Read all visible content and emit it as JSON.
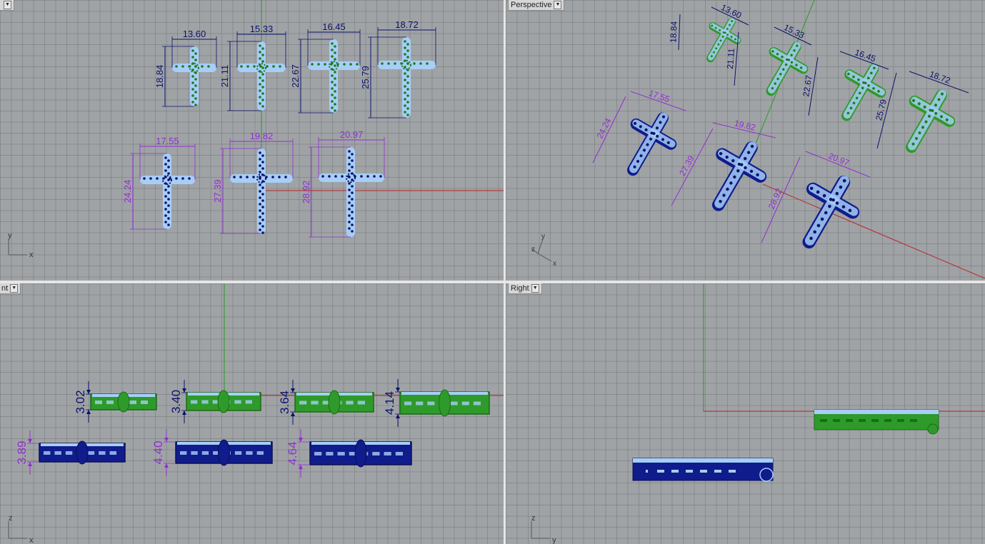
{
  "viewports": {
    "top": {
      "label": "",
      "axes": {
        "y": "y",
        "x": "x"
      }
    },
    "perspective": {
      "label": "Perspective",
      "axes": {
        "y": "y",
        "x": "x",
        "z": "z"
      }
    },
    "front": {
      "label": "nt",
      "axes": {
        "y": "z",
        "x": "x"
      }
    },
    "right": {
      "label": "Right",
      "axes": {
        "y": "z",
        "x": "y"
      }
    }
  },
  "top_dims": {
    "row1_widths": [
      "13.60",
      "15.33",
      "16.45",
      "18.72"
    ],
    "row1_heights": [
      "18.84",
      "21.11",
      "22.67",
      "25.79"
    ],
    "row2_widths": [
      "17.55",
      "19.82",
      "20.97"
    ],
    "row2_heights": [
      "24.24",
      "27.39",
      "28.92"
    ]
  },
  "persp_dims": {
    "row1_widths": [
      "13.60",
      "15.33",
      "16.45",
      "18.72"
    ],
    "row1_heights": [
      "18.84",
      "21.11",
      "22.67",
      "25.79"
    ],
    "row2_widths": [
      "17.55",
      "19.82",
      "20.97"
    ],
    "row2_heights": [
      "24.24",
      "27.39",
      "28.92"
    ]
  },
  "front_dims": {
    "green_thickness": [
      "3.02",
      "3.40",
      "3.64",
      "4.14"
    ],
    "blue_thickness": [
      "3.89",
      "4.40",
      "4.64"
    ]
  },
  "colors": {
    "viewport_bg": "#a0a3a6",
    "dim_dark": "#0c1268",
    "dim_purple": "#8f2fd0",
    "green_solid": "#2e9a2a",
    "blue_solid": "#101b8c",
    "highlight": "#a7cef7",
    "axis_red": "#b33a3a",
    "axis_green": "#3d9a3d"
  }
}
